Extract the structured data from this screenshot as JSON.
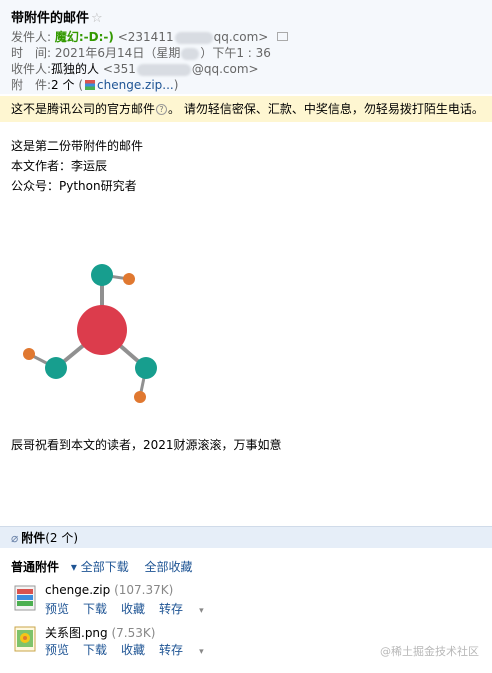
{
  "subject": "带附件的邮件",
  "sender": {
    "label": "发件人:",
    "name": "魔幻:-D:-)",
    "email_prefix": "<231411",
    "email_suffix": "qq.com>"
  },
  "time": {
    "label": "时　间:",
    "value_start": "2021年6月14日（星期",
    "value_end": "）下午1 : 36"
  },
  "recipient": {
    "label": "收件人:",
    "name": "孤独的人",
    "email_prefix": "<351",
    "email_suffix": "@qq.com>"
  },
  "attachment_summary": {
    "label": "附　件:",
    "count": "2 个",
    "paren_open": "(",
    "file": "chenge.zip...",
    "paren_close": ")"
  },
  "warning": {
    "text_before": "这不是腾讯公司的官方邮件",
    "qmark": "?",
    "text_after": "。 请勿轻信密保、汇款、中奖信息，勿轻易拨打陌生电话。"
  },
  "body": {
    "line1": "这是第二份带附件的邮件",
    "line2": "本文作者：李运辰",
    "line3": "公众号：Python研究者",
    "closing": "辰哥祝看到本文的读者，2021财源滚滚，万事如意"
  },
  "molecule_colors": {
    "center": "#dc3c4c",
    "teal": "#179e8e",
    "orange": "#e07830",
    "bond": "#909090"
  },
  "attachments": {
    "title": "附件",
    "count": "(2 个)",
    "type_label": "普通附件",
    "download_all": "全部下载",
    "save_all": "全部收藏",
    "files": [
      {
        "name": "chenge.zip",
        "size": "(107.37K)"
      },
      {
        "name": "关系图.png",
        "size": "(7.53K)"
      }
    ],
    "actions": {
      "preview": "预览",
      "download": "下载",
      "collect": "收藏",
      "forward": "转存"
    }
  },
  "watermark": "@稀土掘金技术社区"
}
